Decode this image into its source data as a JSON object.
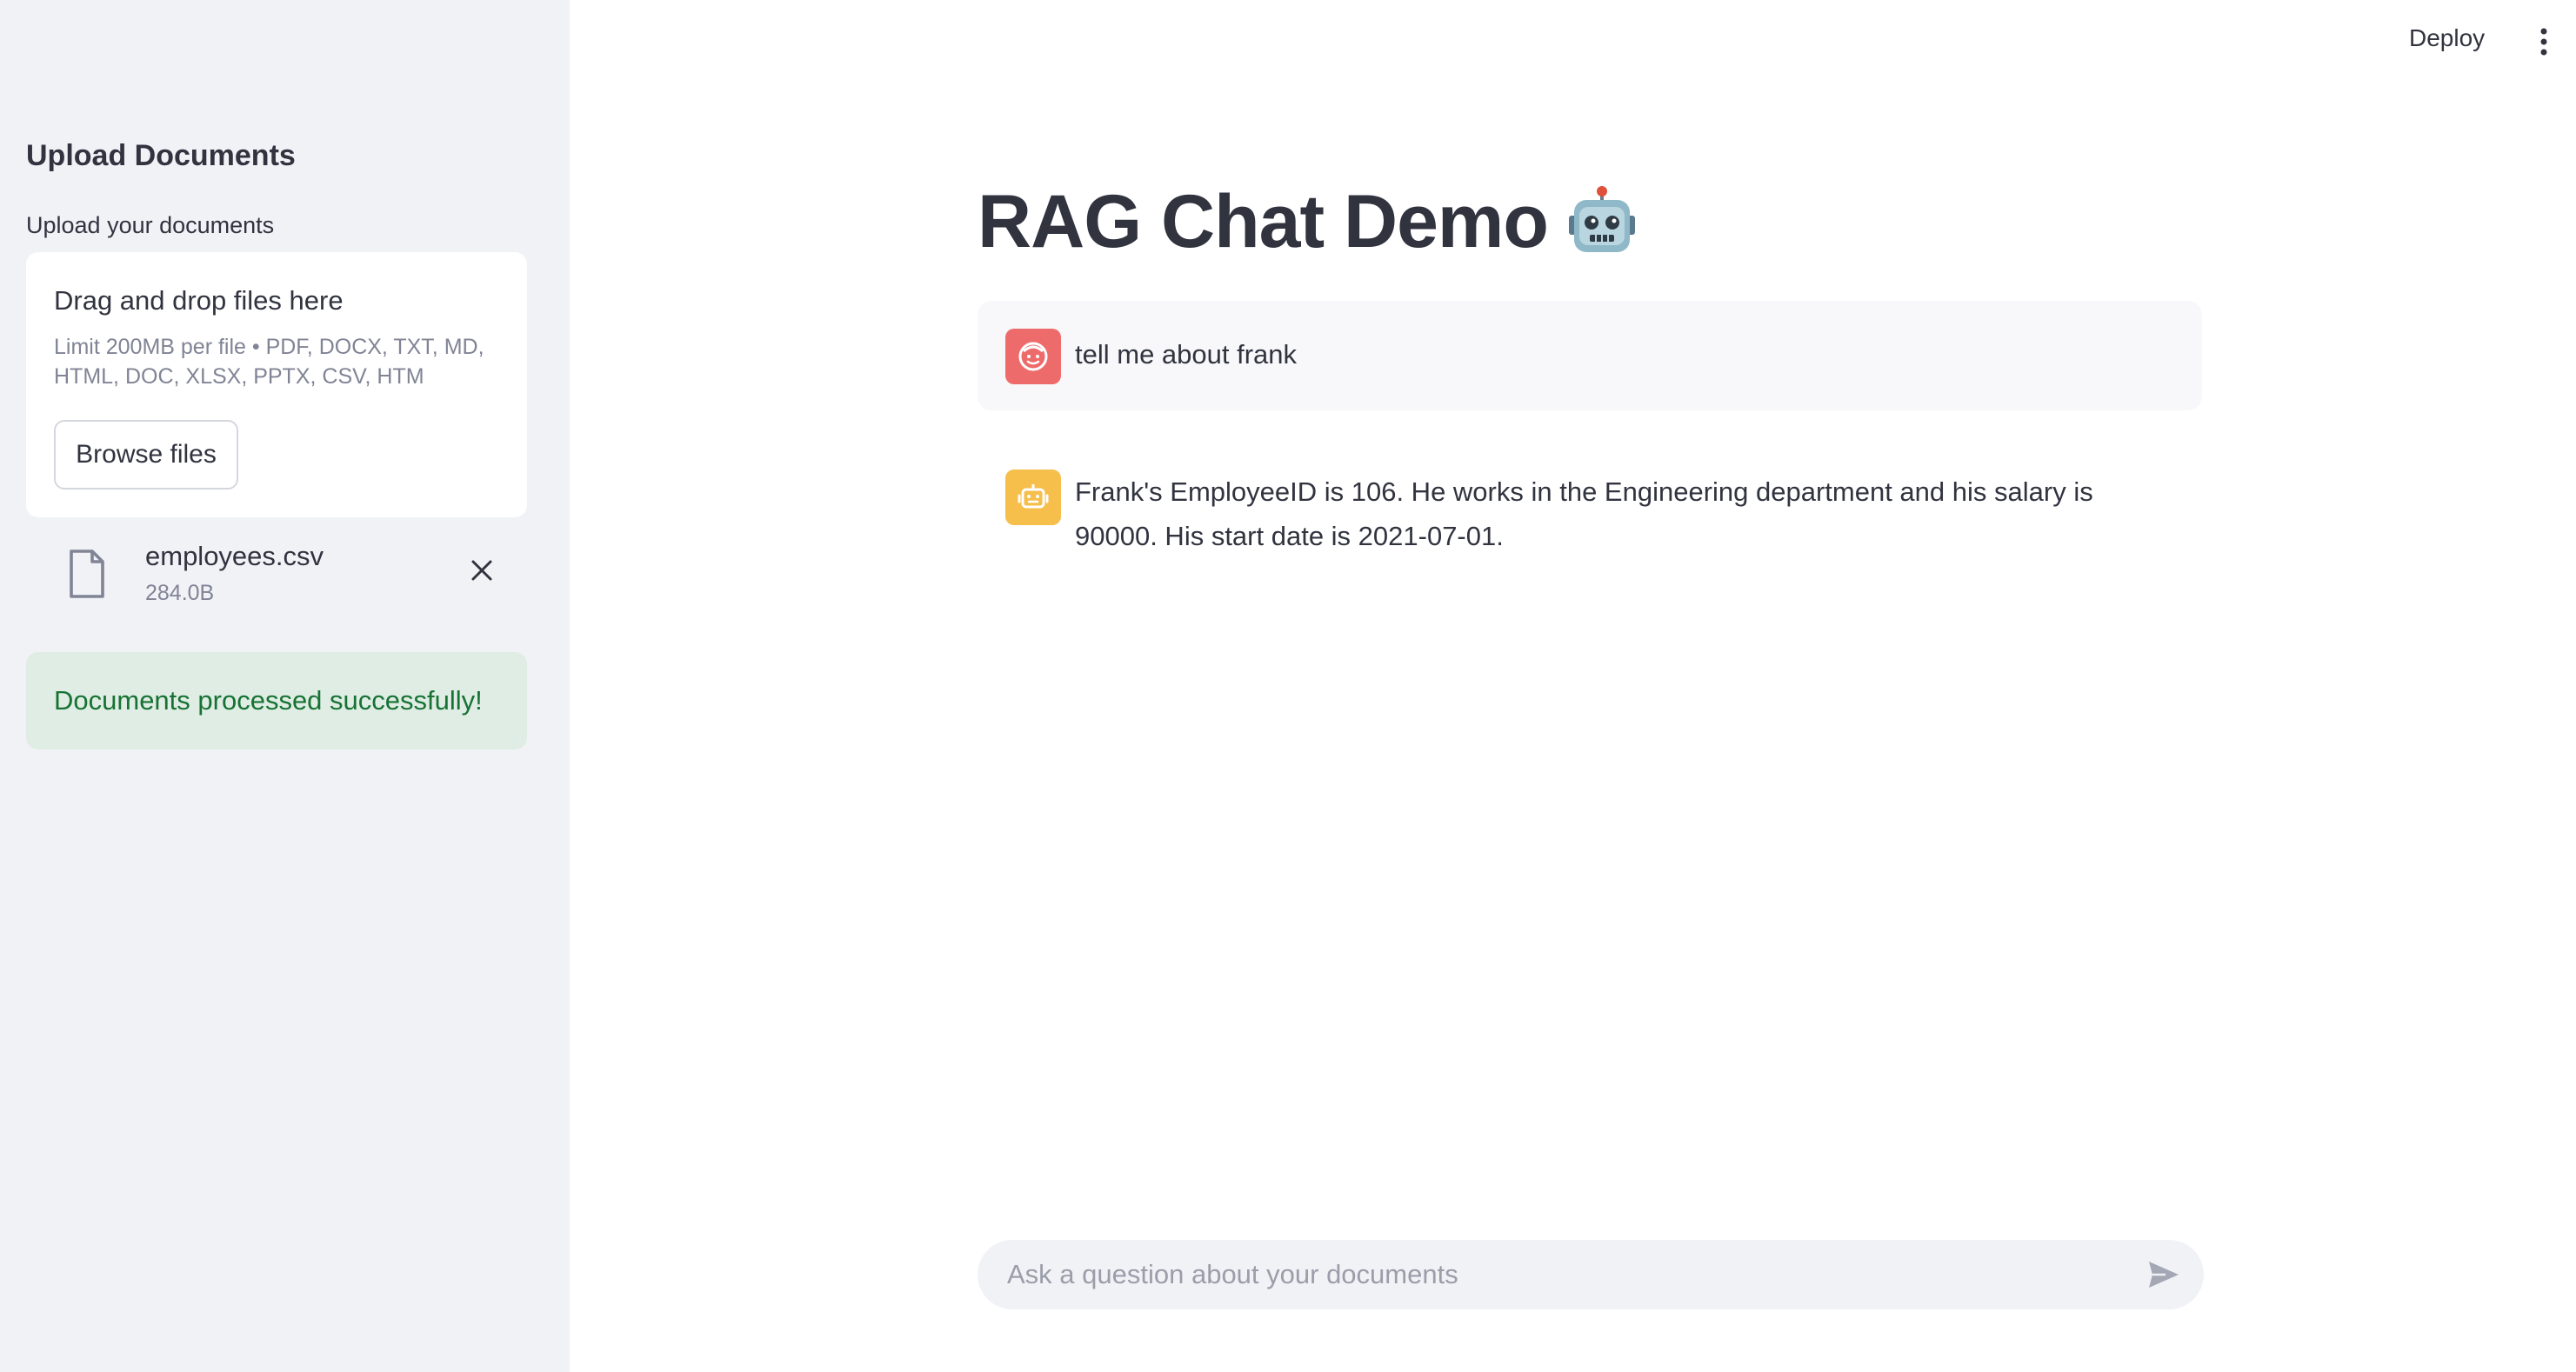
{
  "header": {
    "deploy_label": "Deploy",
    "menu_icon": "vertical-dots-icon"
  },
  "sidebar": {
    "heading": "Upload Documents",
    "upload_label": "Upload your documents",
    "dropzone": {
      "title": "Drag and drop files here",
      "limit_text": "Limit 200MB per file • PDF, DOCX, TXT, MD, HTML, DOC, XLSX, PPTX, CSV, HTM",
      "browse_label": "Browse files"
    },
    "file": {
      "name": "employees.csv",
      "size": "284.0B",
      "icon": "file-icon",
      "remove_icon": "close-icon"
    },
    "success_message": "Documents processed successfully!"
  },
  "main": {
    "title": "RAG Chat Demo",
    "title_icon": "robot-emoji",
    "messages": [
      {
        "role": "user",
        "text": "tell me about frank"
      },
      {
        "role": "assistant",
        "text": "Frank's EmployeeID is 106. He works in the Engineering department and his salary is 90000. His start date is 2021-07-01."
      }
    ],
    "chat_input": {
      "placeholder": "Ask a question about your documents"
    }
  },
  "colors": {
    "sidebar_bg": "#f0f2f6",
    "user_avatar": "#ee6b6b",
    "bot_avatar": "#f6be4b",
    "success_bg": "#dfede4",
    "success_text": "#177233"
  }
}
